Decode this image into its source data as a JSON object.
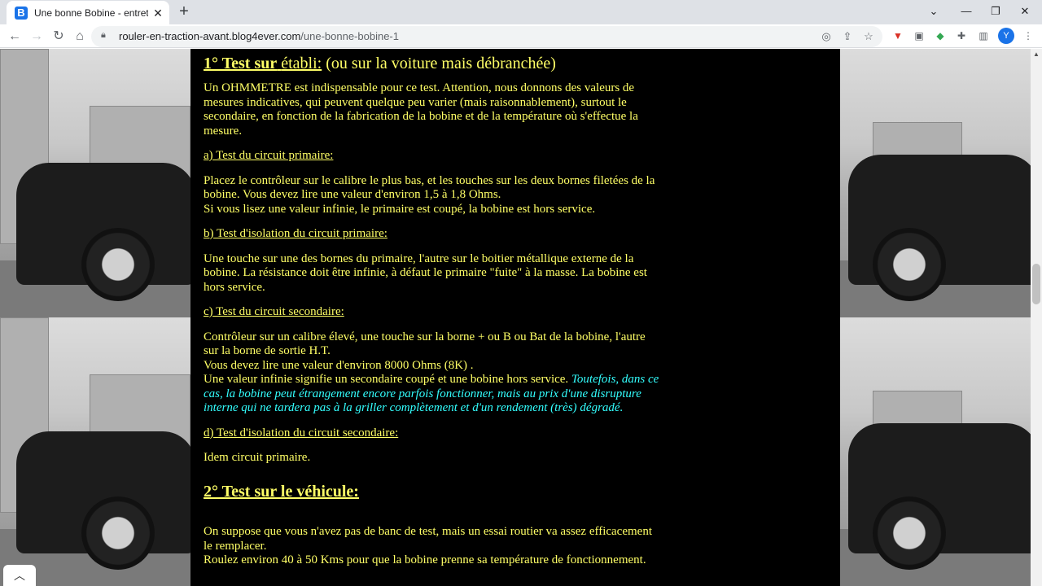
{
  "browser": {
    "tab_title": "Une bonne Bobine - entretenir u",
    "favicon_letter": "B",
    "url_domain": "rouler-en-traction-avant.blog4ever.com",
    "url_path": "/une-bonne-bobine-1",
    "avatar_letter": "Y",
    "icons": [
      "back-icon",
      "forward-icon",
      "reload-icon",
      "home-icon",
      "lock-icon",
      "eye-off-icon",
      "share-icon",
      "star-icon",
      "extension-icons",
      "puzzle-icon",
      "sidebar-icon",
      "menu-icon"
    ]
  },
  "article": {
    "section1": {
      "title_underlined": "1° Test sur",
      "title_rest_underlined": "établi:",
      "title_suffix": " (ou sur la voiture mais débranchée)"
    },
    "intro": "Un OHMMETRE est indispensable pour ce test. Attention, nous donnons des valeurs de mesures indicatives, qui peuvent quelque peu varier (mais raisonnablement), surtout le secondaire, en fonction de la fabrication de la bobine et de la température où s'effectue la mesure.",
    "a_title": "a) Test du circuit primaire:",
    "a_line1": "Placez le contrôleur sur le calibre le plus bas, et les touches sur les deux bornes filetées de la bobine. Vous devez lire une valeur d'environ 1,5 à 1,8 Ohms.",
    "a_line2": "Si vous lisez une valeur infinie, le primaire est coupé, la bobine est hors service.",
    "b_title": "b) Test d'isolation du circuit primaire:",
    "b_text": "Une touche sur une des bornes du primaire, l'autre sur le boitier métallique externe de la bobine. La résistance doit être infinie, à défaut le primaire \"fuite\" à la masse. La bobine est hors service.",
    "c_title": "c) Test du circuit secondaire:",
    "c_line1": "Contrôleur sur un calibre élevé, une touche sur la borne + ou B ou Bat de la bobine, l'autre sur la borne de sortie H.T.",
    "c_line2": "Vous devez lire une valeur d'environ 8000 Ohms (8K) .",
    "c_line3": "Une valeur infinie signifie un secondaire coupé et une bobine hors service.",
    "c_note": "Toutefois, dans ce cas, la bobine peut étrangement encore parfois fonctionner, mais au prix d'une disrupture interne qui ne tardera pas à la griller complètement et d'un rendement (très) dégradé.",
    "d_title": "d) Test d'isolation du circuit secondaire:",
    "d_text": "Idem circuit primaire.",
    "section2_title": "2° Test sur le véhicule:",
    "s2_line1": "On suppose que vous n'avez pas de banc de test, mais un essai routier va assez efficacement le remplacer.",
    "s2_line2": "Roulez environ 40 à 50 Kms pour que la bobine prenne sa température de fonctionnement."
  },
  "colors": {
    "text": "#ffff66",
    "note": "#33ffff",
    "content_bg": "#000000"
  }
}
